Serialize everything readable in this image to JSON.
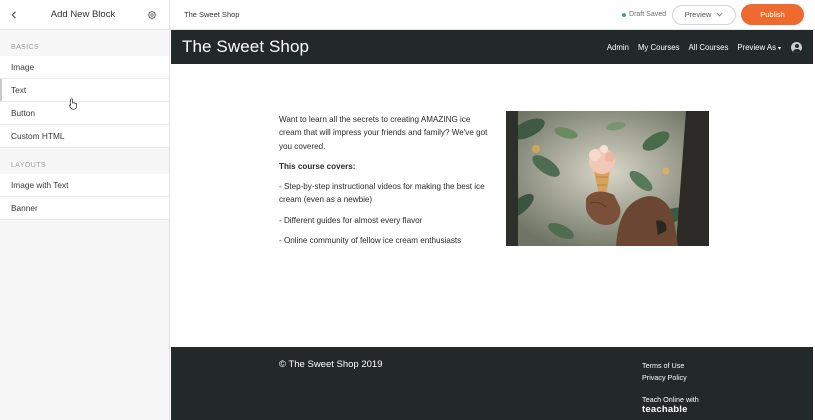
{
  "sidebar": {
    "title": "Add New Block",
    "back_icon": "chevron-left-icon",
    "settings_icon": "gear-icon",
    "sections": [
      {
        "label": "BASICS",
        "items": [
          "Image",
          "Text",
          "Button",
          "Custom HTML"
        ]
      },
      {
        "label": "LAYOUTS",
        "items": [
          "Image with Text",
          "Banner"
        ]
      }
    ]
  },
  "topbar": {
    "school_name": "The Sweet Shop",
    "status": "Draft Saved",
    "preview_label": "Preview",
    "publish_label": "Publish",
    "colors": {
      "publish": "#ef6a2f",
      "status_dot": "#3aa38a"
    }
  },
  "site": {
    "brand": "The Sweet Shop",
    "nav": [
      "Admin",
      "My Courses",
      "All Courses",
      "Preview As"
    ],
    "nav_bg": "#232829",
    "content": {
      "intro": "Want to learn all the secrets to creating AMAZING ice cream that will impress your friends and family? We've got you covered.",
      "covers_heading": "This course covers:",
      "bullets": [
        "- Step-by-step instructional videos for making the best ice cream (even as a newbie)",
        "- Different guides for almost every flavor",
        "- Online community of fellow ice cream enthusiasts"
      ]
    },
    "footer": {
      "copyright": "© The Sweet Shop 2019",
      "links": [
        "Terms of Use",
        "Privacy Policy"
      ],
      "teach_line": "Teach Online with",
      "teach_brand": "teachable"
    }
  }
}
